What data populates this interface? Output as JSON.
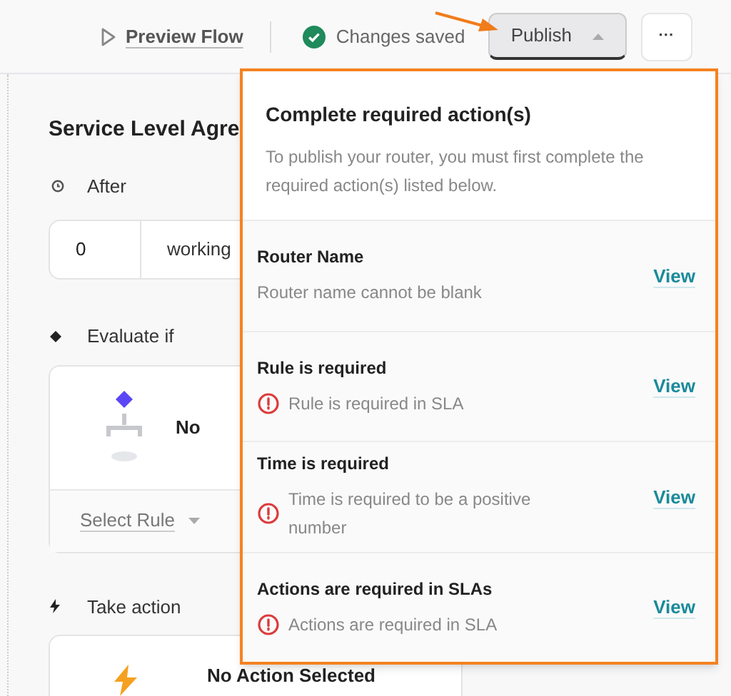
{
  "toolbar": {
    "preview": "Preview Flow",
    "status": "Changes saved",
    "publish": "Publish",
    "more": "···"
  },
  "editor": {
    "title": "Service Level Agre",
    "after": {
      "label": "After",
      "amount": "0",
      "unit": "working"
    },
    "evaluate": {
      "label": "Evaluate if",
      "empty": "No",
      "select": "Select Rule"
    },
    "action": {
      "label": "Take action",
      "empty": "No Action Selected"
    }
  },
  "popover": {
    "title": "Complete required action(s)",
    "description": "To publish your router, you must first complete the required action(s) listed below.",
    "items": [
      {
        "title": "Router Name",
        "message": "Router name cannot be blank",
        "error": false,
        "link": "View"
      },
      {
        "title": "Rule is required",
        "message": "Rule is required in SLA",
        "error": true,
        "link": "View"
      },
      {
        "title": "Time is required",
        "message": "Time is required to be a positive number",
        "error": true,
        "link": "View"
      },
      {
        "title": "Actions are required in SLAs",
        "message": "Actions are required in SLA",
        "error": true,
        "link": "View"
      }
    ]
  }
}
